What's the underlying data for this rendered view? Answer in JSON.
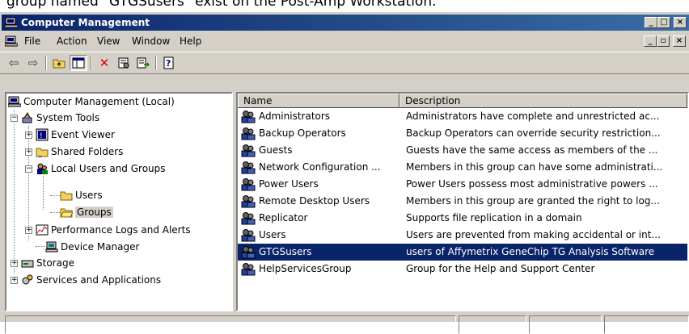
{
  "caption": "group named \"GTGSusers\" exist on the Post-Amp Workstation.",
  "window": {
    "title": "Computer Management",
    "caption_buttons": [
      "_",
      "□",
      "×"
    ]
  },
  "menu": {
    "items": [
      {
        "label": "File"
      },
      {
        "label": "Action"
      },
      {
        "label": "View"
      },
      {
        "label": "Window"
      },
      {
        "label": "Help"
      }
    ],
    "mdi_buttons": [
      "_",
      "▫",
      "×"
    ]
  },
  "toolbar": {
    "icons": [
      "back-arrow-icon",
      "forward-arrow-icon",
      "up-folder-icon",
      "show-tree-icon",
      "delete-icon",
      "properties-icon",
      "export-list-icon",
      "help-icon"
    ],
    "glyphs": {
      "back": "⇦",
      "forward": "⇨",
      "delete": "✕"
    }
  },
  "tree": {
    "root": "Computer Management (Local)",
    "system_tools": "System Tools",
    "event_viewer": "Event Viewer",
    "shared_folders": "Shared Folders",
    "local_users_groups": "Local Users and Groups",
    "users": "Users",
    "groups": "Groups",
    "perf_logs": "Performance Logs and Alerts",
    "device_manager": "Device Manager",
    "storage": "Storage",
    "services_apps": "Services and Applications",
    "selected": "Groups"
  },
  "list": {
    "columns": [
      "Name",
      "Description"
    ],
    "rows": [
      {
        "name": "Administrators",
        "desc": "Administrators have complete and unrestricted ac..."
      },
      {
        "name": "Backup Operators",
        "desc": "Backup Operators can override security restriction..."
      },
      {
        "name": "Guests",
        "desc": "Guests have the same access as members of the ..."
      },
      {
        "name": "Network Configuration ...",
        "desc": "Members in this group can have some administrati..."
      },
      {
        "name": "Power Users",
        "desc": "Power Users possess most administrative powers ..."
      },
      {
        "name": "Remote Desktop Users",
        "desc": "Members in this group are granted the right to log..."
      },
      {
        "name": "Replicator",
        "desc": "Supports file replication in a domain"
      },
      {
        "name": "Users",
        "desc": "Users are prevented from making accidental or int..."
      },
      {
        "name": "GTGSusers",
        "desc": "users of Affymetrix GeneChip TG Analysis Software"
      },
      {
        "name": "HelpServicesGroup",
        "desc": "Group for the Help and Support Center"
      }
    ],
    "selected_row": 8
  },
  "colors": {
    "selection": "#0a246a",
    "titlebar_start": "#0a246a",
    "titlebar_end": "#3a6ea5",
    "chrome": "#d4d0c8"
  }
}
